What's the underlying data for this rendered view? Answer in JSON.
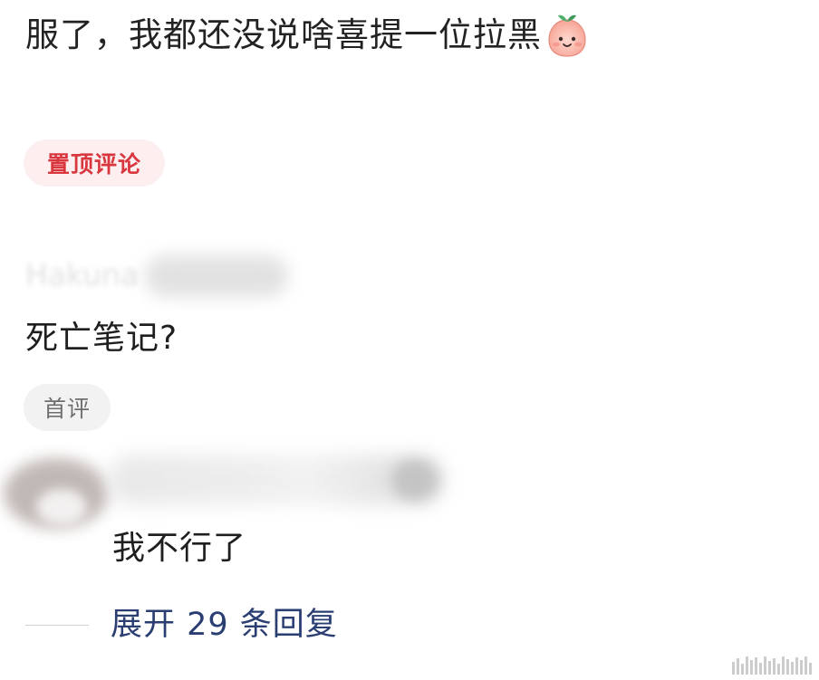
{
  "post": {
    "text": "服了，我都还没说啥喜提一位拉黑",
    "emoji": "peach-face-icon"
  },
  "pinned": {
    "label": "置顶评论"
  },
  "comment": {
    "username_partial": "Hakuna",
    "text": "死亡笔记?",
    "badge": "首评"
  },
  "reply": {
    "text": "我不行了"
  },
  "expand": {
    "label": "展开 29 条回复"
  },
  "colors": {
    "pin_badge_bg": "#fdeef0",
    "pin_badge_text": "#d9363e",
    "link": "#2a3e72"
  }
}
